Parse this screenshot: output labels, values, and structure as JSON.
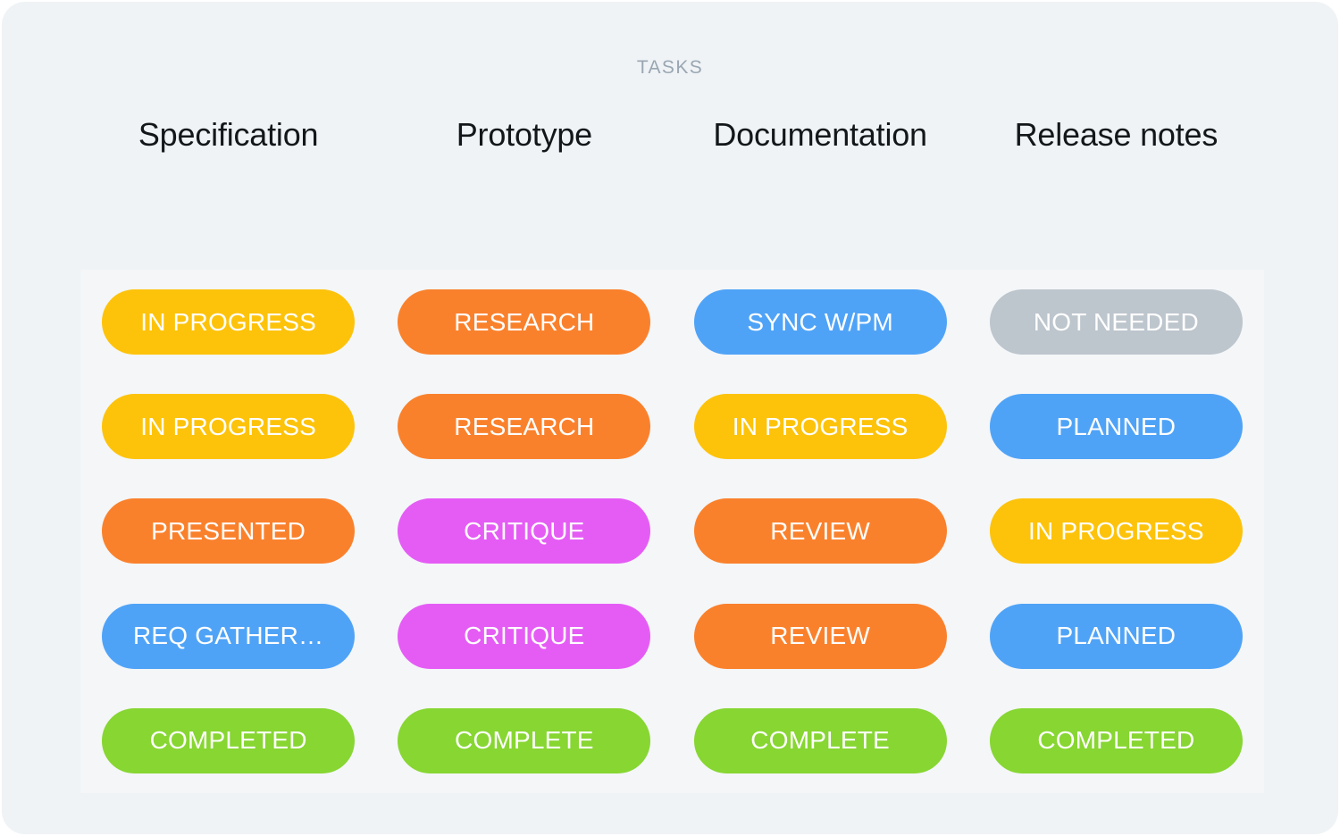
{
  "card": {
    "title": "TASKS",
    "background_color": "#eff3f6",
    "panel_color": "#f4f6f8"
  },
  "columns": [
    {
      "label": "Specification"
    },
    {
      "label": "Prototype"
    },
    {
      "label": "Documentation"
    },
    {
      "label": "Release notes"
    }
  ],
  "status_colors": {
    "in_progress": "#fdc30b",
    "research": "#fa812c",
    "presented": "#fa812c",
    "review": "#fa812c",
    "sync": "#4fa3f7",
    "planned": "#4fa3f7",
    "req_gathering": "#4fa3f7",
    "not_needed": "#bdc5cd",
    "critique": "#e55cf5",
    "complete": "#87d632"
  },
  "rows": [
    {
      "cells": [
        {
          "label": "IN PROGRESS",
          "color": "#fdc30b"
        },
        {
          "label": "RESEARCH",
          "color": "#fa812c"
        },
        {
          "label": "SYNC W/PM",
          "color": "#4fa3f7"
        },
        {
          "label": "NOT NEEDED",
          "color": "#bdc5cd"
        }
      ]
    },
    {
      "cells": [
        {
          "label": "IN PROGRESS",
          "color": "#fdc30b"
        },
        {
          "label": "RESEARCH",
          "color": "#fa812c"
        },
        {
          "label": "IN PROGRESS",
          "color": "#fdc30b"
        },
        {
          "label": "PLANNED",
          "color": "#4fa3f7"
        }
      ]
    },
    {
      "cells": [
        {
          "label": "PRESENTED",
          "color": "#fa812c"
        },
        {
          "label": "CRITIQUE",
          "color": "#e55cf5"
        },
        {
          "label": "REVIEW",
          "color": "#fa812c"
        },
        {
          "label": "IN PROGRESS",
          "color": "#fdc30b"
        }
      ]
    },
    {
      "cells": [
        {
          "label": "REQ GATHER…",
          "color": "#4fa3f7"
        },
        {
          "label": "CRITIQUE",
          "color": "#e55cf5"
        },
        {
          "label": "REVIEW",
          "color": "#fa812c"
        },
        {
          "label": "PLANNED",
          "color": "#4fa3f7"
        }
      ]
    },
    {
      "cells": [
        {
          "label": "COMPLETED",
          "color": "#87d632"
        },
        {
          "label": "COMPLETE",
          "color": "#87d632"
        },
        {
          "label": "COMPLETE",
          "color": "#87d632"
        },
        {
          "label": "COMPLETED",
          "color": "#87d632"
        }
      ]
    }
  ]
}
